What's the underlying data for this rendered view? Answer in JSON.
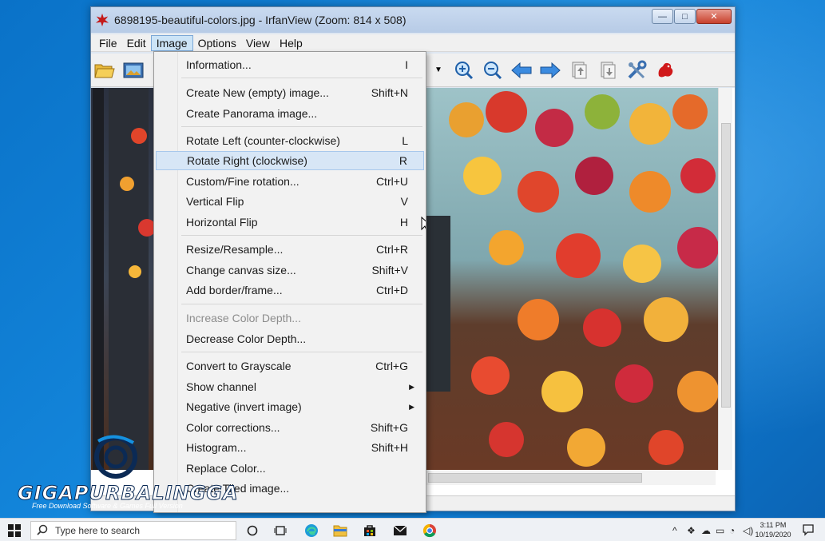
{
  "window": {
    "title": "6898195-beautiful-colors.jpg - IrfanView (Zoom: 814 x 508)",
    "controls": {
      "minimize": "—",
      "maximize": "□",
      "close": "✕"
    }
  },
  "menubar": {
    "items": [
      {
        "label": "File"
      },
      {
        "label": "Edit"
      },
      {
        "label": "Image",
        "active": true
      },
      {
        "label": "Options"
      },
      {
        "label": "View"
      },
      {
        "label": "Help"
      }
    ]
  },
  "toolbar": {
    "icons": [
      "folder-open-icon",
      "slideshow-icon",
      "zoom-in-icon",
      "zoom-out-icon",
      "previous-arrow-icon",
      "next-arrow-icon",
      "page-up-icon",
      "page-down-icon",
      "settings-tools-icon",
      "irfanview-logo-icon"
    ]
  },
  "image_menu": {
    "items": [
      {
        "label": "Information...",
        "shortcut": "I"
      },
      {
        "label": "Create New (empty) image...",
        "shortcut": "Shift+N"
      },
      {
        "label": "Create Panorama image...",
        "shortcut": ""
      },
      {
        "label": "Rotate Left (counter-clockwise)",
        "shortcut": "L"
      },
      {
        "label": "Rotate Right (clockwise)",
        "shortcut": "R",
        "highlighted": true
      },
      {
        "label": "Custom/Fine rotation...",
        "shortcut": "Ctrl+U"
      },
      {
        "label": "Vertical Flip",
        "shortcut": "V"
      },
      {
        "label": "Horizontal Flip",
        "shortcut": "H"
      },
      {
        "label": "Resize/Resample...",
        "shortcut": "Ctrl+R"
      },
      {
        "label": "Change canvas size...",
        "shortcut": "Shift+V"
      },
      {
        "label": "Add border/frame...",
        "shortcut": "Ctrl+D"
      },
      {
        "label": "Increase Color Depth...",
        "shortcut": "",
        "disabled": true
      },
      {
        "label": "Decrease Color Depth...",
        "shortcut": ""
      },
      {
        "label": "Convert to Grayscale",
        "shortcut": "Ctrl+G"
      },
      {
        "label": "Show channel",
        "shortcut": "",
        "submenu": true
      },
      {
        "label": "Negative (invert image)",
        "shortcut": "",
        "submenu": true
      },
      {
        "label": "Color corrections...",
        "shortcut": "Shift+G"
      },
      {
        "label": "Histogram...",
        "shortcut": "Shift+H"
      },
      {
        "label": "Replace Color...",
        "shortcut": ""
      },
      {
        "label": "Create Tiled image...",
        "shortcut": ""
      }
    ]
  },
  "watermark": {
    "brand": "GIGAPURBALINGGA",
    "tagline": "Free Download Software & Games Full Version"
  },
  "taskbar": {
    "search_placeholder": "Type here to search",
    "clock_time": "3:11 PM",
    "clock_date": "10/19/2020"
  },
  "colors": {
    "accent": "#0078d7",
    "menu_highlight": "#d7e6f6",
    "titlebar": "#c9daf0"
  }
}
